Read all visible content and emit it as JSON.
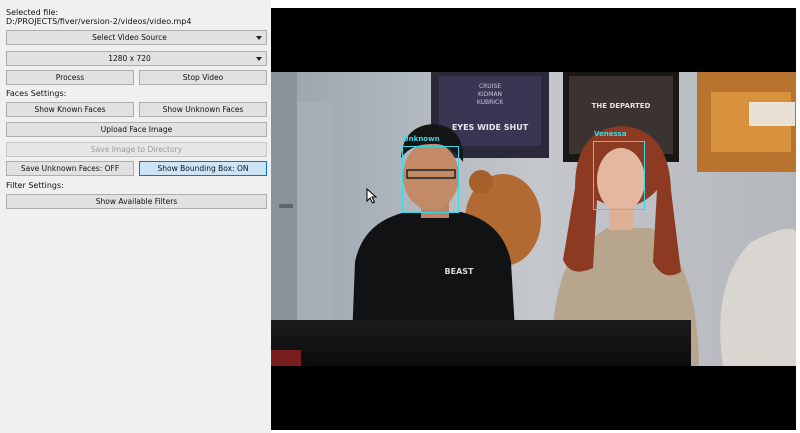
{
  "sidebar": {
    "selected_file_label": "Selected file:",
    "selected_file_path": "D:/PROJECTS/fiver/version-2/videos/video.mp4",
    "video_source_select": "Select Video Source",
    "resolution_select": "1280 x 720",
    "process_button": "Process",
    "stop_video_button": "Stop Video",
    "faces_settings_label": "Faces Settings:",
    "show_known_faces_button": "Show Known Faces",
    "show_unknown_faces_button": "Show Unknown Faces",
    "upload_face_image_button": "Upload Face Image",
    "save_image_button": "Save Image to Directory",
    "save_unknown_faces_button": "Save Unknown Faces: OFF",
    "show_bounding_box_button": "Show Bounding Box: ON",
    "filter_settings_label": "Filter Settings:",
    "show_filters_button": "Show Available Filters"
  },
  "video": {
    "faces": [
      {
        "label": "Unknown"
      },
      {
        "label": "Venessa"
      }
    ],
    "poster_text": [
      "CRUISE",
      "KIDMAN",
      "KUBRICK",
      "EYES WIDE SHUT"
    ],
    "poster2_text": "THE DEPARTED",
    "shirt_text": "BEAST"
  },
  "colors": {
    "panel_bg": "#f0f0f0",
    "button_bg": "#e1e1e1",
    "button_active_bg": "#cce4f7",
    "accent_border": "#0078d7",
    "bounding_box": "#38d9e6",
    "video_bg": "#000000"
  }
}
